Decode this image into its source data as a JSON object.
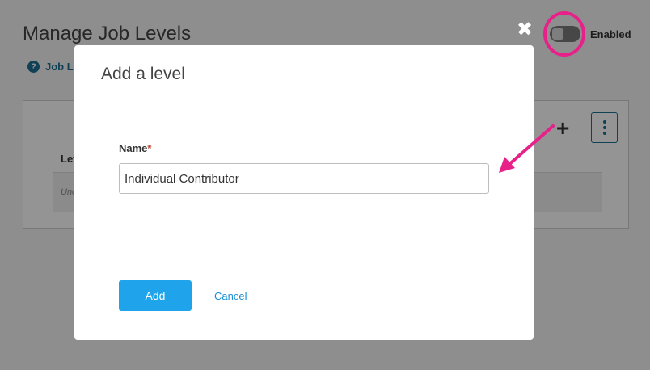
{
  "background_page": {
    "title": "Manage Job Levels",
    "help_link_label": "Job Le",
    "help_icon_glyph": "?",
    "table_header": "Lev",
    "table_row_text": "Unc",
    "toggle_label": "Enabled",
    "toggle_state": "off",
    "plus_glyph": "+"
  },
  "overlay": {
    "close_glyph": "✖"
  },
  "modal": {
    "title": "Add a level",
    "name_label": "Name",
    "required_marker": "*",
    "name_value": "Individual Contributor",
    "add_label": "Add",
    "cancel_label": "Cancel"
  },
  "colors": {
    "accent": "#1fa4eb",
    "annotation": "#e8218a",
    "link": "#1a8fd4"
  }
}
